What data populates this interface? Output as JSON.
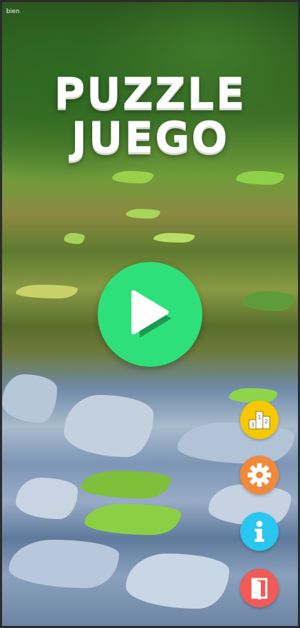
{
  "status_bar": {
    "text": "bien"
  },
  "title": {
    "line1": "PUZZLE",
    "line2": "JUEGO"
  },
  "buttons": {
    "play": {
      "icon": "play-icon",
      "color": "#2ee07a"
    },
    "ranking": {
      "icon": "podium-icon",
      "color": "#f6c800",
      "places": [
        "1",
        "2",
        "3"
      ]
    },
    "settings": {
      "icon": "gear-icon",
      "color": "#f2883a"
    },
    "info": {
      "icon": "info-icon",
      "color": "#29c6ef"
    },
    "exit": {
      "icon": "exit-door-icon",
      "color": "#f05a57"
    }
  }
}
